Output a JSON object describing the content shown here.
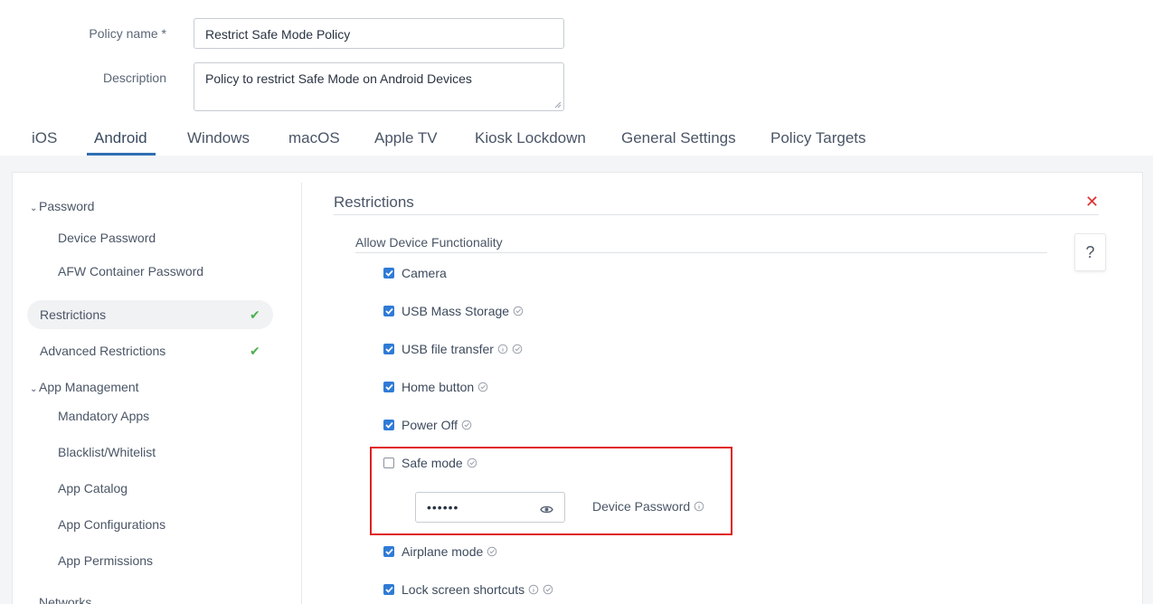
{
  "form": {
    "policy_name_label": "Policy name *",
    "policy_name_value": "Restrict Safe Mode Policy",
    "description_label": "Description",
    "description_value": "Policy to restrict Safe Mode on Android Devices"
  },
  "tabs": [
    {
      "label": "iOS",
      "active": false
    },
    {
      "label": "Android",
      "active": true
    },
    {
      "label": "Windows",
      "active": false
    },
    {
      "label": "macOS",
      "active": false
    },
    {
      "label": "Apple TV",
      "active": false
    },
    {
      "label": "Kiosk Lockdown",
      "active": false
    },
    {
      "label": "General Settings",
      "active": false
    },
    {
      "label": "Policy Targets",
      "active": false
    }
  ],
  "sidebar": {
    "password_group": "Password",
    "device_password": "Device Password",
    "afw_container_password": "AFW Container Password",
    "restrictions": "Restrictions",
    "advanced_restrictions": "Advanced Restrictions",
    "app_management_group": "App Management",
    "mandatory_apps": "Mandatory Apps",
    "blacklist_whitelist": "Blacklist/Whitelist",
    "app_catalog": "App Catalog",
    "app_configurations": "App Configurations",
    "app_permissions": "App Permissions",
    "networks_group": "Networks"
  },
  "main": {
    "section_title": "Restrictions",
    "help_label": "?",
    "subsection_title": "Allow Device Functionality",
    "options": [
      {
        "label": "Camera",
        "checked": true
      },
      {
        "label": "USB Mass Storage",
        "checked": true
      },
      {
        "label": "USB file transfer",
        "checked": true
      },
      {
        "label": "Home button",
        "checked": true
      },
      {
        "label": "Power Off",
        "checked": true
      },
      {
        "label": "Safe mode",
        "checked": false
      },
      {
        "label": "Airplane mode",
        "checked": true
      },
      {
        "label": "Lock screen shortcuts",
        "checked": true
      }
    ],
    "device_password_masked": "••••••",
    "device_password_label": "Device Password"
  },
  "colors": {
    "accent": "#2f7bd6",
    "tab_underline": "#2f6fb3",
    "success": "#4caf50",
    "danger": "#e02020"
  }
}
